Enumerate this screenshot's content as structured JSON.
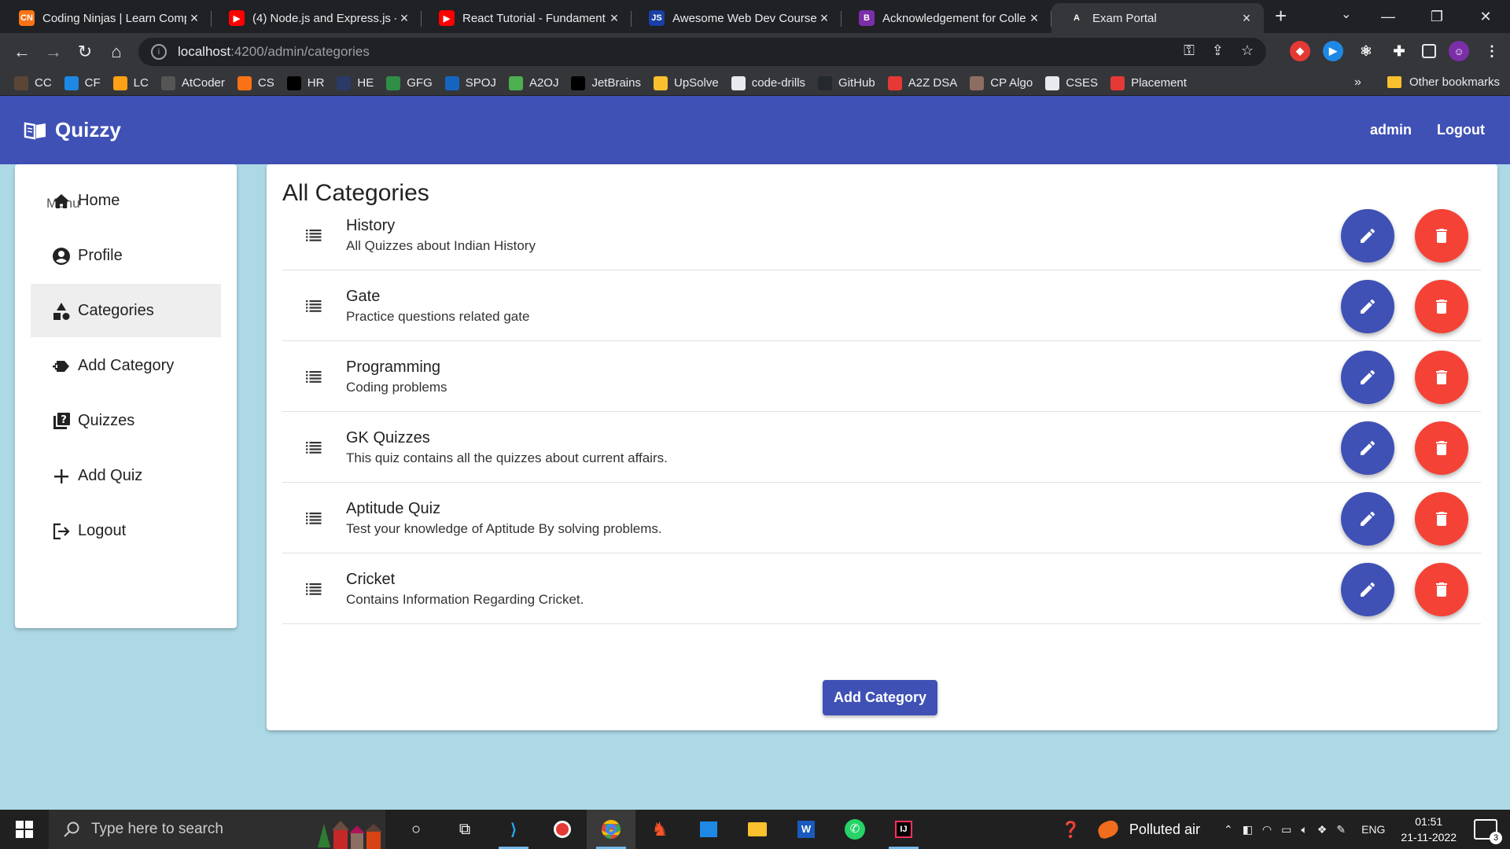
{
  "browser": {
    "tabs": [
      {
        "title": "Coding Ninjas | Learn Comp",
        "favicon_color": "#f97316",
        "favicon_text": "CN"
      },
      {
        "title": "(4) Node.js and Express.js -",
        "favicon_color": "#ff0000",
        "favicon_text": "▶"
      },
      {
        "title": "React Tutorial - Fundament",
        "favicon_color": "#ff0000",
        "favicon_text": "▶"
      },
      {
        "title": "Awesome Web Dev Course",
        "favicon_color": "#1a3fa6",
        "favicon_text": "JS"
      },
      {
        "title": "Acknowledgement for Colle",
        "favicon_color": "#7b2ea8",
        "favicon_text": "B"
      },
      {
        "title": "Exam Portal",
        "favicon_color": "#35363a",
        "favicon_text": "A"
      }
    ],
    "url_host": "localhost",
    "url_path": ":4200/admin/categories",
    "bookmarks": [
      {
        "label": "CC",
        "color": "#5b4636"
      },
      {
        "label": "CF",
        "color": "#1e88e5"
      },
      {
        "label": "LC",
        "color": "#ffa116"
      },
      {
        "label": "AtCoder",
        "color": "#555555"
      },
      {
        "label": "CS",
        "color": "#f97316"
      },
      {
        "label": "HR",
        "color": "#000000"
      },
      {
        "label": "HE",
        "color": "#2b3a67"
      },
      {
        "label": "GFG",
        "color": "#2f8d46"
      },
      {
        "label": "SPOJ",
        "color": "#1565c0"
      },
      {
        "label": "A2OJ",
        "color": "#4caf50"
      },
      {
        "label": "JetBrains",
        "color": "#000000"
      },
      {
        "label": "UpSolve",
        "color": "#fbc02d"
      },
      {
        "label": "code-drills",
        "color": "#e8eaed"
      },
      {
        "label": "GitHub",
        "color": "#24292e"
      },
      {
        "label": "A2Z DSA",
        "color": "#e53935"
      },
      {
        "label": "CP Algo",
        "color": "#8d6e63"
      },
      {
        "label": "CSES",
        "color": "#e8eaed"
      },
      {
        "label": "Placement",
        "color": "#e53935"
      }
    ],
    "more": "»",
    "other_bookmarks": "Other bookmarks"
  },
  "app": {
    "brand": "Quizzy",
    "user": "admin",
    "logout": "Logout",
    "primary_color": "#3f51b5",
    "danger_color": "#f44336"
  },
  "sidebar": {
    "label": "Menu",
    "items": [
      {
        "label": "Home",
        "icon": "home-icon"
      },
      {
        "label": "Profile",
        "icon": "account-circle-icon"
      },
      {
        "label": "Categories",
        "icon": "category-icon",
        "active": true
      },
      {
        "label": "Add Category",
        "icon": "add-category-icon"
      },
      {
        "label": "Quizzes",
        "icon": "quiz-icon"
      },
      {
        "label": "Add Quiz",
        "icon": "plus-icon"
      },
      {
        "label": "Logout",
        "icon": "logout-icon"
      }
    ]
  },
  "main": {
    "title": "All Categories",
    "categories": [
      {
        "title": "History",
        "description": "All Quizzes about Indian History"
      },
      {
        "title": "Gate",
        "description": "Practice questions related gate"
      },
      {
        "title": "Programming",
        "description": "Coding problems"
      },
      {
        "title": "GK Quizzes",
        "description": "This quiz contains all the quizzes about current affairs."
      },
      {
        "title": "Aptitude Quiz",
        "description": "Test your knowledge of Aptitude By solving problems."
      },
      {
        "title": "Cricket",
        "description": "Contains Information Regarding Cricket."
      }
    ],
    "add_button": "Add Category"
  },
  "taskbar": {
    "search_placeholder": "Type here to search",
    "weather": "Polluted air",
    "language": "ENG",
    "time": "01:51",
    "date": "21-11-2022",
    "notifications": "3"
  }
}
